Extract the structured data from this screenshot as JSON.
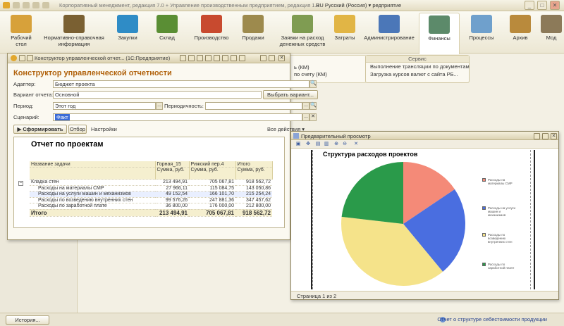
{
  "app": {
    "title": "Корпоративный менеджмент, редакция 7.0 + Управление производственным предприятием, редакция 1.3",
    "language": "RU Русский (Россия)",
    "lang_suffix": "редприятие",
    "controls": [
      "_",
      "□",
      "✕"
    ]
  },
  "ribbon": {
    "items": [
      {
        "label": "Рабочий стол",
        "color": "#d7a13a"
      },
      {
        "label": "Нормативно-справочная информация",
        "color": "#7a6032"
      },
      {
        "label": "Закупки",
        "color": "#2f8cc6"
      },
      {
        "label": "Склад",
        "color": "#5a8e34"
      },
      {
        "label": "Производство",
        "color": "#c84a2f"
      },
      {
        "label": "Продажи",
        "color": "#9d8a4d"
      },
      {
        "label": "Заявки на расход денежных средств",
        "color": "#7f9c52"
      },
      {
        "label": "Затраты",
        "color": "#e1b545"
      },
      {
        "label": "Администрирование",
        "color": "#4b77b8"
      },
      {
        "label": "Финансы",
        "color": "#5c8a6a"
      },
      {
        "label": "Процессы",
        "color": "#6fa0cc"
      },
      {
        "label": "Архив",
        "color": "#b98a3c"
      },
      {
        "label": "Мод",
        "color": "#8c7a59"
      }
    ]
  },
  "bg_panel": {
    "lines": [
      "ь (КМ)",
      "по счету (КМ)"
    ]
  },
  "service_panel": {
    "title": "Сервис",
    "lines": [
      "Выполнение трансляции по документам",
      "Загрузка курсов валют с сайта РБ..."
    ]
  },
  "main_window": {
    "title": "Конструктор управленческой отчет... (1С:Предприятие)",
    "heading": "Конструктор управленческой отчетности",
    "adapter_label": "Адаптер:",
    "adapter_value": "Бюджет проекта",
    "variant_label": "Вариант отчета:",
    "variant_value": "Основной",
    "choose_variant_button": "Выбрать вариант...",
    "period_label": "Период:",
    "period_value": "Этот год",
    "periodicity_label": "Периодичность:",
    "periodicity_value": "",
    "scenario_label": "Сценарий:",
    "scenario_value": "Факт",
    "generate_button": "Сформировать",
    "select_button": "Отбор",
    "settings_button": "Настройки",
    "all_actions": "Все действия ▾",
    "ellipsis": "...",
    "search_glyph": "🔍",
    "clear_glyph": "✕"
  },
  "report": {
    "title": "Отчет по проектам",
    "columns": [
      "Название задачи",
      "Горная_15",
      "Рижский пер.4",
      "Итого"
    ],
    "subheaders": [
      "Сумма, руб.",
      "Сумма, руб.",
      "Сумма, руб."
    ],
    "group": {
      "name": "Кладка стен",
      "values": [
        "213 494,91",
        "705 067,81",
        "918 562,72"
      ]
    },
    "rows": [
      {
        "name": "Расходы на материалы СМР",
        "values": [
          "27 966,11",
          "115 084,75",
          "143 050,86"
        ]
      },
      {
        "name": "Расходы на услуги машин и механизмов",
        "values": [
          "49 152,54",
          "166 101,70",
          "215 254,24"
        ]
      },
      {
        "name": "Расходы по возведению внутренних стен",
        "values": [
          "99 576,26",
          "247 881,36",
          "347 457,62"
        ]
      },
      {
        "name": "Расходы по заработной плате",
        "values": [
          "36 800,00",
          "176 000,00",
          "212 800,00"
        ]
      }
    ],
    "total": {
      "name": "Итого",
      "values": [
        "213 494,91",
        "705 067,81",
        "918 562,72"
      ]
    }
  },
  "preview": {
    "title": "Предварительный просмотр",
    "page_info": "Страница 1 из 2"
  },
  "chart_data": {
    "type": "pie",
    "title": "Структура расходов проектов",
    "categories": [
      "Расходы на материалы СМР",
      "Расходы на услуги машин и механизмов",
      "Расходы по возведению внутренних стен",
      "Расходы по заработной плате"
    ],
    "values": [
      143050.86,
      215254.24,
      347457.62,
      212800.0
    ],
    "colors": [
      "#f48a78",
      "#4a6ee0",
      "#f5e38a",
      "#2a9a4a"
    ],
    "legend": "right"
  },
  "status": {
    "history_button": "История...",
    "link": "Отчет о структуре себестоимости продукции"
  }
}
